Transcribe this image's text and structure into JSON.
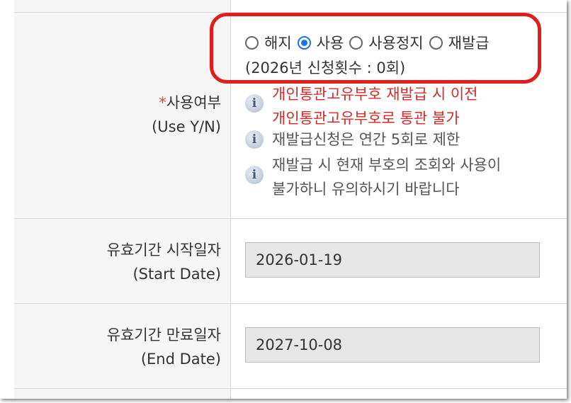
{
  "use_field": {
    "label_ko": "사용여부",
    "label_en": "(Use Y/N)",
    "required_mark": "*",
    "options": [
      "해지",
      "사용",
      "사용정지",
      "재발급"
    ],
    "selected": "사용",
    "reissue_count_text": "(2026년 신청횟수 : 0회)",
    "notices": [
      {
        "lines": [
          "개인통관고유부호 재발급 시 이전",
          "개인통관고유부호로 통관 불가"
        ],
        "color": "#d62a2a"
      },
      {
        "lines": [
          "재발급신청은 연간 5회로 제한"
        ],
        "color": "#555555"
      },
      {
        "lines": [
          "재발급 시 현재 부호의 조회와 사용이",
          "불가하니 유의하시기 바랍니다"
        ],
        "color": "#555555"
      }
    ]
  },
  "start_date": {
    "label_ko": "유효기간 시작일자",
    "label_en": "(Start Date)",
    "value": "2026-01-19"
  },
  "end_date": {
    "label_ko": "유효기간 만료일자",
    "label_en": "(End Date)",
    "value": "2027-10-08"
  },
  "icons": {
    "notice": "info-icon",
    "highlight": "red-rounded-highlight"
  },
  "colors": {
    "radio_selected": "#1a73e8",
    "highlight_border": "#e11d1d",
    "warning_text": "#d62a2a"
  }
}
